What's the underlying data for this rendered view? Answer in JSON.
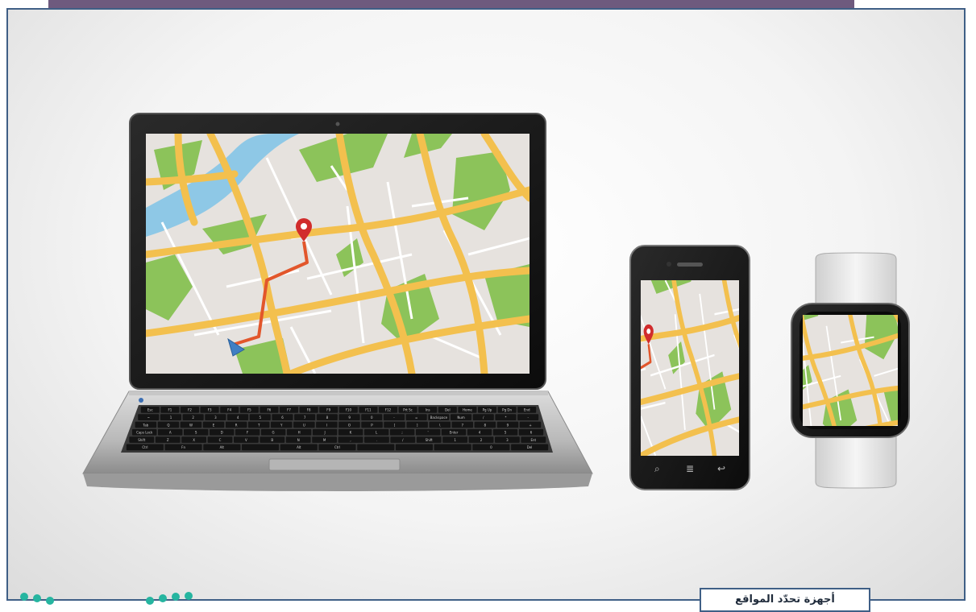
{
  "caption": "أجهزة تحدّد المواقع",
  "colors": {
    "frame_border": "#3f5f86",
    "top_bar": "#6e5a7e",
    "map_bg": "#e6e2de",
    "map_road": "#f3c04e",
    "map_park": "#8cc35a",
    "map_water": "#8ec8e6",
    "route": "#e2562b",
    "pin": "#d12c2c",
    "nav_arrow": "#3f7fc4",
    "dots": "#26b5a0"
  },
  "devices": {
    "laptop": {
      "icon": "laptop-icon"
    },
    "phone": {
      "icon": "smartphone-icon"
    },
    "watch": {
      "icon": "smartwatch-icon"
    }
  },
  "keyboard": {
    "row1": [
      "Esc",
      "F1",
      "F2",
      "F3",
      "F4",
      "F5",
      "F6",
      "F7",
      "F8",
      "F9",
      "F10",
      "F11",
      "F12",
      "Prt Sc",
      "Ins",
      "Del",
      "Home",
      "Pg Up",
      "Pg Dn",
      "End"
    ],
    "row2": [
      "~",
      "1",
      "2",
      "3",
      "4",
      "5",
      "6",
      "7",
      "8",
      "9",
      "0",
      "-",
      "=",
      "Backspace",
      "Num",
      "/",
      "*",
      "-"
    ],
    "row3": [
      "Tab",
      "Q",
      "W",
      "E",
      "R",
      "T",
      "Y",
      "U",
      "I",
      "O",
      "P",
      "[",
      "]",
      "\\",
      "7",
      "8",
      "9",
      "+"
    ],
    "row4": [
      "Caps Lock",
      "A",
      "S",
      "D",
      "F",
      "G",
      "H",
      "J",
      "K",
      "L",
      ";",
      "'",
      "Enter",
      "4",
      "5",
      "6"
    ],
    "row5": [
      "Shift",
      "Z",
      "X",
      "C",
      "V",
      "B",
      "N",
      "M",
      ",",
      ".",
      "/",
      "Shift",
      "1",
      "2",
      "3",
      "Ent"
    ],
    "row6": [
      "Ctrl",
      "Fn",
      "Alt",
      "",
      "Alt",
      "Ctrl",
      "",
      "",
      "",
      "0",
      "Del"
    ]
  }
}
